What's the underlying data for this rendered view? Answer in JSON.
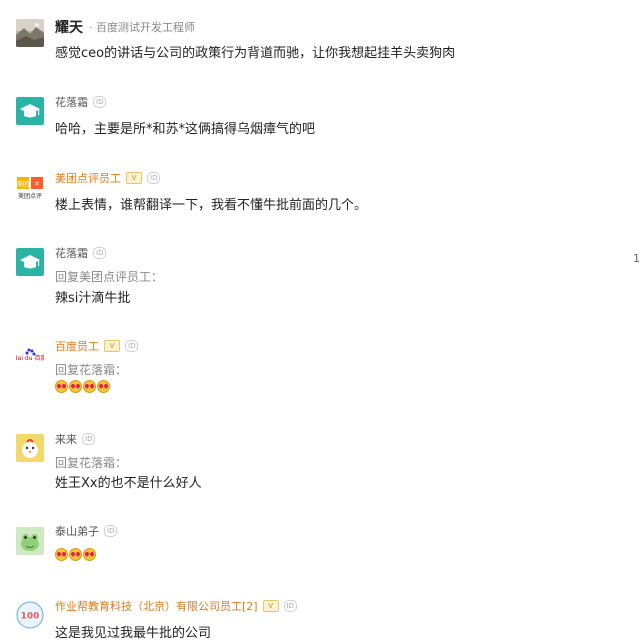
{
  "comments": [
    {
      "name": "耀天",
      "title": "百度测试开发工程师",
      "avatar": "landscape-photo-avatar",
      "text": "感觉ceo的讲话与公司的政策行为背道而驰，让你我想起挂羊头卖狗肉"
    },
    {
      "name": "花落霜",
      "id_badge": "ID",
      "avatar": "graduation-cap-avatar",
      "text": "哈哈，主要是所*和苏*这俩搞得乌烟瘴气的吧"
    },
    {
      "name": "美团点评员工",
      "v_badge": "V",
      "id_badge": "ID",
      "avatar": "meituan-logo-avatar",
      "avatar_text": "美团点评",
      "text": "楼上表情，谁帮翻译一下，我看不懂牛批前面的几个。"
    },
    {
      "name": "花落霜",
      "id_badge": "ID",
      "avatar": "graduation-cap-avatar",
      "reply_to": "回复美团点评员工：",
      "text": "辣si汁滴牛批"
    },
    {
      "name": "百度员工",
      "v_badge": "V",
      "id_badge": "ID",
      "avatar": "baidu-logo-avatar",
      "avatar_text": "Bai du 百度",
      "reply_to": "回复花落霜：",
      "emoji_count": 4
    },
    {
      "name": "来来",
      "id_badge": "ID",
      "avatar": "chick-avatar",
      "reply_to": "回复花落霜：",
      "text": "姓王Xx的也不是什么好人"
    },
    {
      "name": "泰山弟子",
      "id_badge": "ID",
      "avatar": "frog-avatar",
      "emoji_count": 3
    },
    {
      "name": "作业帮教育科技（北京）有限公司员工[2]",
      "v_badge": "V",
      "id_badge": "ID",
      "avatar": "zuoyebang-logo-avatar",
      "avatar_text": "100",
      "text": "这是我见过我最牛批的公司"
    }
  ],
  "edge_digit": "1",
  "colors": {
    "accent_orange": "#e07a1f",
    "cap_teal": "#2bb3a6",
    "meta_gray": "#888888"
  }
}
